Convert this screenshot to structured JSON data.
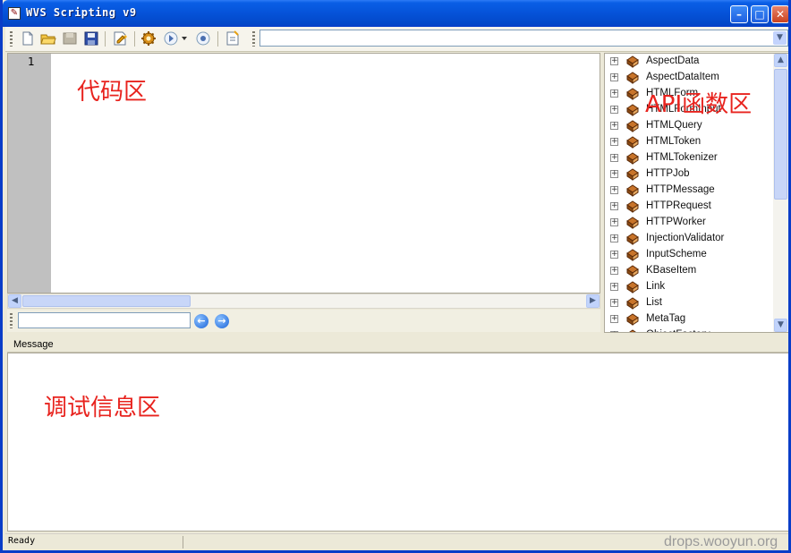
{
  "window": {
    "title": "WVS Scripting v9"
  },
  "toolbar": {
    "buttons": [
      "new-file-icon",
      "open-folder-icon",
      "close-file-icon",
      "save-icon",
      "edit-script-icon",
      "settings-gear-icon",
      "run-icon",
      "stop-icon",
      "properties-icon"
    ],
    "combo_value": ""
  },
  "editor": {
    "line_number": "1",
    "annotation": "代码区"
  },
  "findbar": {
    "search_value": ""
  },
  "api_panel": {
    "annotation": "API函数区",
    "items": [
      "AspectData",
      "AspectDataItem",
      "HTMLForm",
      "HTMLFormInput",
      "HTMLQuery",
      "HTMLToken",
      "HTMLTokenizer",
      "HTTPJob",
      "HTTPMessage",
      "HTTPRequest",
      "HTTPWorker",
      "InjectionValidator",
      "InputScheme",
      "KBaseItem",
      "Link",
      "List",
      "MetaTag",
      "ObjectFactory"
    ]
  },
  "message": {
    "header": "Message",
    "annotation": "调试信息区"
  },
  "status": {
    "text": "Ready"
  },
  "watermark": "drops.wooyun.org"
}
